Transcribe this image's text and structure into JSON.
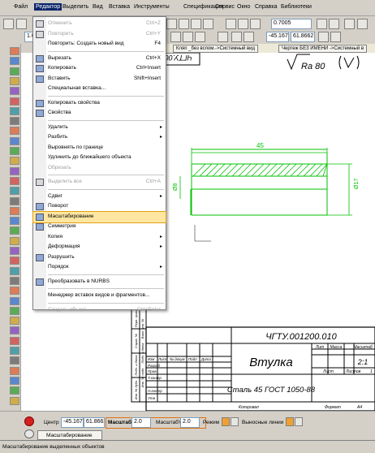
{
  "menubar": {
    "items": [
      "Файл",
      "Редактор",
      "Выделить",
      "Вид",
      "Вставка",
      "Инструменты",
      "Спецификация",
      "Сервис",
      "Окно",
      "Справка",
      "Библиотеки"
    ],
    "active_index": 1
  },
  "toolbar": {
    "zoom_value": "0.7005",
    "coord_x": "-45.167",
    "coord_y": "61.8662",
    "layer_value": "1.0"
  },
  "tabs": [
    "Кляп _без вспом.->Системный вид",
    "Чертеж БЕЗ ИМЕНИ ->Системный в"
  ],
  "menu": {
    "items": [
      {
        "label": "Отменить",
        "shortcut": "Ctrl+Z",
        "disabled": true,
        "icon": "undo-icon"
      },
      {
        "label": "Повторить",
        "shortcut": "Ctrl+Y",
        "disabled": true,
        "icon": "redo-icon"
      },
      {
        "label": "Повторить: Создать новый вид",
        "shortcut": "F4",
        "disabled": false,
        "icon": ""
      },
      {
        "sep": true
      },
      {
        "label": "Вырезать",
        "shortcut": "Ctrl+X",
        "disabled": false,
        "icon": "cut-icon"
      },
      {
        "label": "Копировать",
        "shortcut": "Ctrl+Insert",
        "disabled": false,
        "icon": "copy-icon"
      },
      {
        "label": "Вставить",
        "shortcut": "Shift+Insert",
        "disabled": false,
        "icon": "paste-icon"
      },
      {
        "label": "Специальная вставка...",
        "shortcut": "",
        "disabled": false,
        "icon": ""
      },
      {
        "sep": true
      },
      {
        "label": "Копировать свойства",
        "shortcut": "",
        "disabled": false,
        "icon": "brush-icon"
      },
      {
        "label": "Свойства",
        "shortcut": "",
        "disabled": false,
        "icon": "properties-icon"
      },
      {
        "sep": true
      },
      {
        "label": "Удалить",
        "shortcut": "",
        "submenu": true,
        "disabled": false,
        "icon": ""
      },
      {
        "label": "Разбить",
        "shortcut": "",
        "submenu": true,
        "disabled": false,
        "icon": ""
      },
      {
        "label": "Выровнять по границе",
        "shortcut": "",
        "disabled": false,
        "icon": ""
      },
      {
        "label": "Удлинить до ближайшего объекта",
        "shortcut": "",
        "disabled": false,
        "icon": ""
      },
      {
        "label": "Обрезать",
        "shortcut": "",
        "disabled": true,
        "icon": ""
      },
      {
        "sep": true
      },
      {
        "label": "Выделить все",
        "shortcut": "Ctrl+A",
        "disabled": true,
        "icon": "select-all-icon"
      },
      {
        "sep": true
      },
      {
        "label": "Сдвиг",
        "shortcut": "",
        "submenu": true,
        "disabled": false,
        "icon": ""
      },
      {
        "label": "Поворот",
        "shortcut": "",
        "disabled": false,
        "icon": "rotate-icon"
      },
      {
        "label": "Масштабирование",
        "shortcut": "",
        "disabled": false,
        "highlight": true,
        "icon": "scale-icon"
      },
      {
        "label": "Симметрия",
        "shortcut": "",
        "disabled": false,
        "icon": "mirror-icon"
      },
      {
        "label": "Копия",
        "shortcut": "",
        "submenu": true,
        "disabled": false,
        "icon": ""
      },
      {
        "label": "Деформация",
        "shortcut": "",
        "submenu": true,
        "disabled": false,
        "icon": ""
      },
      {
        "label": "Разрушить",
        "shortcut": "",
        "disabled": false,
        "icon": "destroy-icon"
      },
      {
        "label": "Порядок",
        "shortcut": "",
        "submenu": true,
        "disabled": false,
        "icon": ""
      },
      {
        "sep": true
      },
      {
        "label": "Преобразовать в NURBS",
        "shortcut": "",
        "disabled": false,
        "icon": "nurbs-icon"
      },
      {
        "sep": true
      },
      {
        "label": "Менеджер вставок видов и фрагментов...",
        "shortcut": "",
        "disabled": false,
        "icon": ""
      },
      {
        "sep": true
      },
      {
        "label": "Создать объект",
        "shortcut": "Ctrl+Enter",
        "disabled": true,
        "icon": ""
      }
    ]
  },
  "drawing": {
    "roughness": "Ra 80",
    "dim_length": "45",
    "dim_d_left": "Ø8",
    "dim_d_right": "Ø17",
    "stamp_code_top": "ЧГТУ.001200.010",
    "title_code": "ЧГТУ.001200.010",
    "part_name": "Втулка",
    "material": "Сталь 45 ГОСТ 1050-88",
    "copied_label": "Копировал",
    "format_label": "Формат",
    "format_value": "А4",
    "col_lit": "Лит",
    "col_mass": "Масса",
    "col_scale": "Масштаб",
    "scale_value": "2:1",
    "sheet_label": "Лист",
    "sheets_label": "Листов",
    "sheets_value": "1",
    "row_izm": "Изм",
    "row_list": "Лист",
    "row_doc": "№ докум",
    "row_sign": "Подп",
    "row_date": "Дата",
    "row_razrab": "Разраб",
    "row_prov": "Пров",
    "row_tkontr": "Т.контр",
    "row_nkontr": "Н.контр",
    "row_utv": "Утв",
    "side_labels": [
      "Перв. примен.",
      "Справ. №",
      "Подп. и дата",
      "Инв. № дубл.",
      "Взам. инв. №",
      "Подп. и дата",
      "Инв. № подл."
    ]
  },
  "bottom_panel": {
    "center_label": "Центр",
    "center_x": "-45.167",
    "center_y": "61.8662",
    "scale_x_label": "МасштабX",
    "scale_x": "2.0",
    "scale_y_label": "МасштабY",
    "scale_y": "2.0",
    "mode_label": "Режим",
    "ext_lines_label": "Выносные линии",
    "tab_label": "Масштабирование"
  },
  "status": "Масштабирование выделенных объектов"
}
